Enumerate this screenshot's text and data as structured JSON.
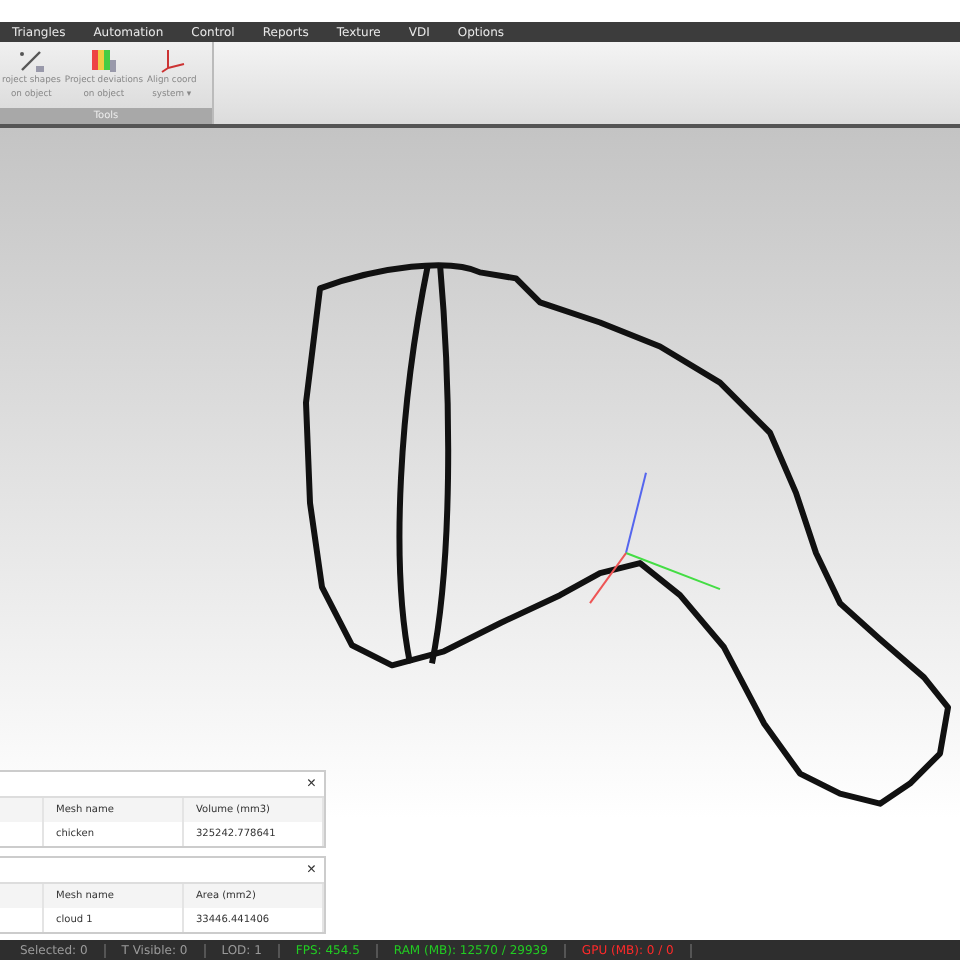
{
  "menu": [
    "Triangles",
    "Automation",
    "Control",
    "Reports",
    "Texture",
    "VDI",
    "Options"
  ],
  "ribbon": {
    "buttons": [
      {
        "kind": "shapes",
        "lines": [
          "roject shapes",
          "on object"
        ]
      },
      {
        "kind": "deviations",
        "lines": [
          "Project deviations",
          "on object"
        ]
      },
      {
        "kind": "align",
        "lines": [
          "Align coord",
          "system ▾"
        ]
      }
    ],
    "group_label": "Tools"
  },
  "panels": [
    {
      "columns": [
        "Mesh name",
        "Volume (mm3)"
      ],
      "row": [
        "chicken",
        "325242.778641"
      ],
      "close": "×"
    },
    {
      "columns": [
        "Mesh name",
        "Area (mm2)"
      ],
      "row": [
        "cloud 1",
        "33446.441406"
      ],
      "close": "×"
    }
  ],
  "status_bar": [
    {
      "text": "Selected: 0",
      "color": "#9a9a9a"
    },
    {
      "text": "T Visible: 0",
      "color": "#9a9a9a"
    },
    {
      "text": "LOD: 1",
      "color": "#9a9a9a"
    },
    {
      "text": "FPS: 454.5",
      "color": "#22cc22"
    },
    {
      "text": "RAM (MB): 12570 / 29939",
      "color": "#22cc22"
    },
    {
      "text": "GPU (MB): 0 / 0",
      "color": "#ff2a2a"
    }
  ]
}
